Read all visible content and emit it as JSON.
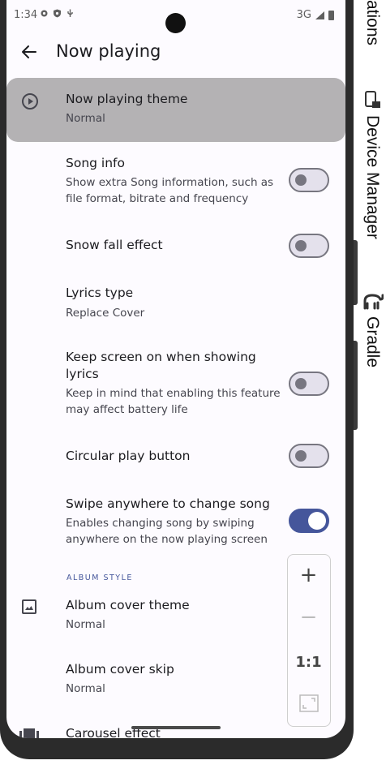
{
  "status_bar": {
    "time": "1:34",
    "network": "3G"
  },
  "app_bar": {
    "title": "Now playing"
  },
  "items": [
    {
      "title": "Now playing theme",
      "subtitle": "Normal"
    },
    {
      "title": "Song info",
      "subtitle_line1": "Show extra Song information, such as",
      "subtitle_line2": "file format, bitrate and frequency",
      "toggle": false
    },
    {
      "title": "Snow fall effect",
      "toggle": false
    },
    {
      "title": "Lyrics type",
      "subtitle": "Replace Cover"
    },
    {
      "title_line1": "Keep screen on when showing",
      "title_line2": "lyrics",
      "subtitle_line1": "Keep in mind that enabling this feature",
      "subtitle_line2": "may affect battery life",
      "toggle": false
    },
    {
      "title": "Circular play button",
      "toggle": false
    },
    {
      "title": "Swipe anywhere to change song",
      "subtitle_line1": "Enables changing song by swiping",
      "subtitle_line2": "anywhere on the now playing screen",
      "toggle": true
    },
    {
      "title": "Album cover theme",
      "subtitle": "Normal"
    },
    {
      "title": "Album cover skip",
      "subtitle": "Normal"
    },
    {
      "title": "Carousel effect"
    }
  ],
  "section_header": "ALBUM STYLE",
  "zoom_controls": {
    "zoom_in": "+",
    "zoom_out": "−",
    "actual_size": "1:1"
  },
  "ide_sidebar": {
    "tab1": "ations",
    "tab2": "Device Manager",
    "tab3": "Gradle"
  },
  "colors": {
    "accent": "#45569b",
    "highlight": "#b4b2b4",
    "background": "#fdfbff"
  }
}
